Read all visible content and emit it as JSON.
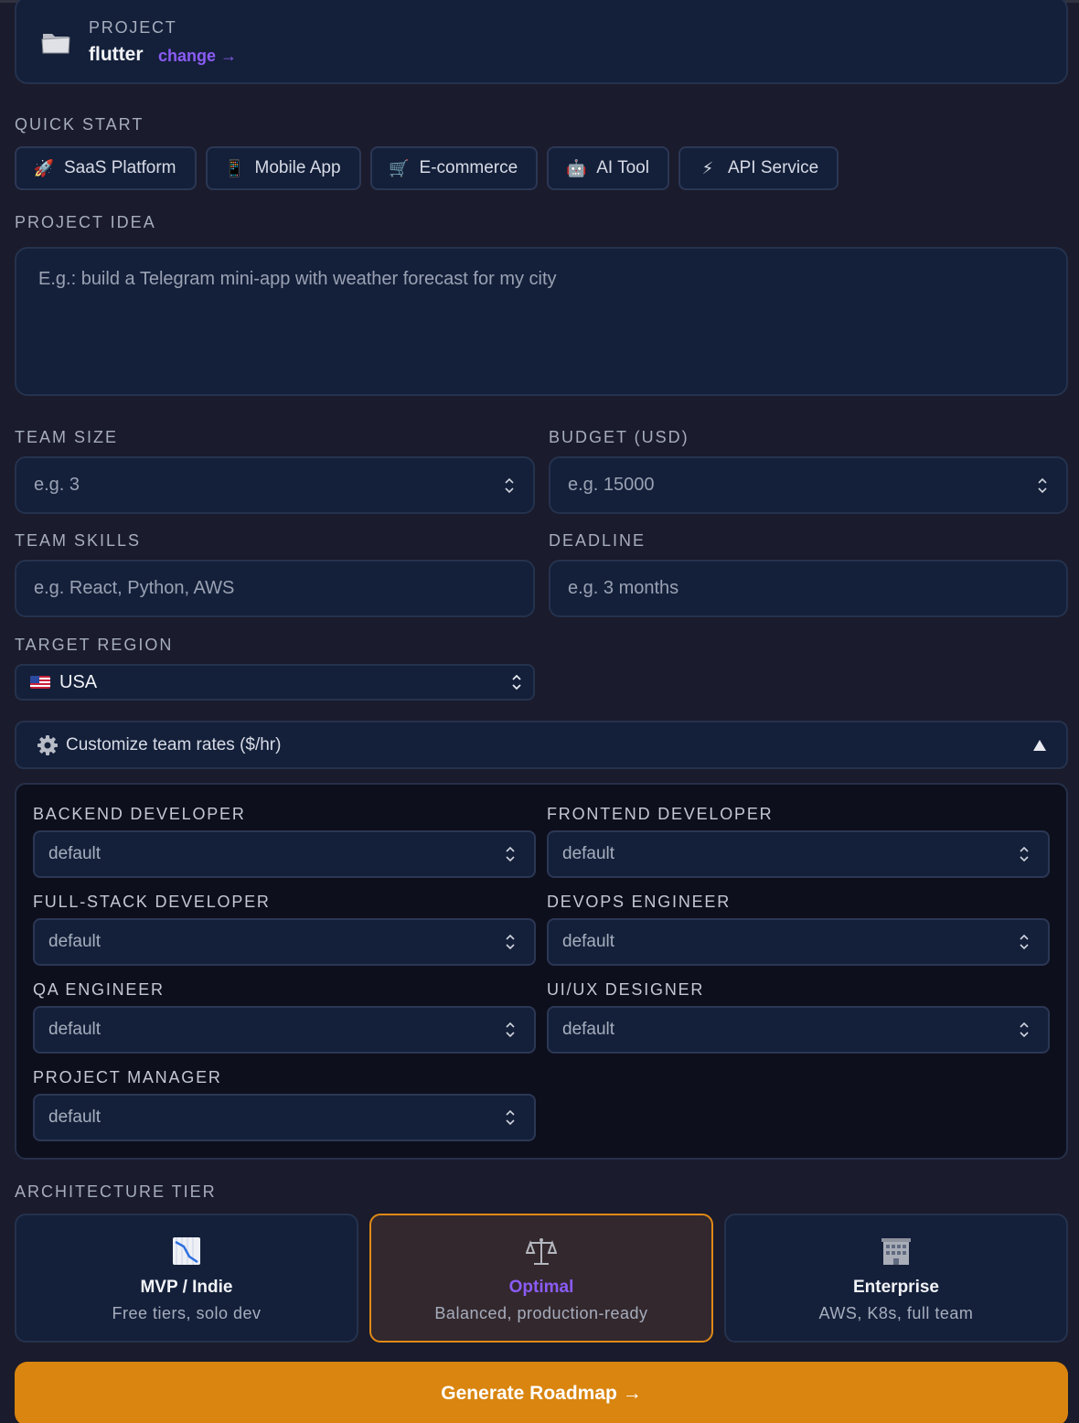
{
  "project": {
    "label": "PROJECT",
    "name": "flutter",
    "change_link": "change →"
  },
  "quick_start": {
    "label": "QUICK START",
    "chips": [
      {
        "icon": "rocket-icon",
        "emoji": "🚀",
        "label": "SaaS Platform"
      },
      {
        "icon": "phone-icon",
        "emoji": "📱",
        "label": "Mobile App"
      },
      {
        "icon": "cart-icon",
        "emoji": "🛒",
        "label": "E-commerce"
      },
      {
        "icon": "robot-icon",
        "emoji": "🤖",
        "label": "AI Tool"
      },
      {
        "icon": "lightning-icon",
        "emoji": "⚡",
        "label": "API Service"
      }
    ]
  },
  "idea": {
    "label": "PROJECT IDEA",
    "placeholder": "E.g.: build a Telegram mini-app with weather forecast for my city",
    "value": ""
  },
  "team_size": {
    "label": "TEAM SIZE",
    "placeholder": "e.g. 3"
  },
  "budget": {
    "label": "BUDGET (USD)",
    "placeholder": "e.g. 15000"
  },
  "team_skills": {
    "label": "TEAM SKILLS",
    "placeholder": "e.g. React, Python, AWS"
  },
  "deadline": {
    "label": "DEADLINE",
    "placeholder": "e.g. 3 months"
  },
  "region": {
    "label": "TARGET REGION",
    "value": "USA",
    "icon": "us-flag-icon"
  },
  "rates": {
    "toggle_label": "Customize team rates ($/hr)",
    "expanded": true,
    "roles": [
      {
        "label": "BACKEND DEVELOPER",
        "placeholder": "default"
      },
      {
        "label": "FRONTEND DEVELOPER",
        "placeholder": "default"
      },
      {
        "label": "FULL-STACK DEVELOPER",
        "placeholder": "default"
      },
      {
        "label": "DEVOPS ENGINEER",
        "placeholder": "default"
      },
      {
        "label": "QA ENGINEER",
        "placeholder": "default"
      },
      {
        "label": "UI/UX DESIGNER",
        "placeholder": "default"
      },
      {
        "label": "PROJECT MANAGER",
        "placeholder": "default"
      }
    ]
  },
  "architecture": {
    "label": "ARCHITECTURE TIER",
    "tiers": [
      {
        "icon": "chart-down-icon",
        "name": "MVP / Indie",
        "desc": "Free tiers, solo dev",
        "selected": false
      },
      {
        "icon": "balance-scale-icon",
        "name": "Optimal",
        "desc": "Balanced, production-ready",
        "selected": true
      },
      {
        "icon": "office-building-icon",
        "name": "Enterprise",
        "desc": "AWS, K8s, full team",
        "selected": false
      }
    ]
  },
  "generate_button": "Generate Roadmap →",
  "colors": {
    "accent": "#d9850f",
    "link": "#8b5cf6",
    "background": "#1a1b2c",
    "card": "#14203a"
  }
}
